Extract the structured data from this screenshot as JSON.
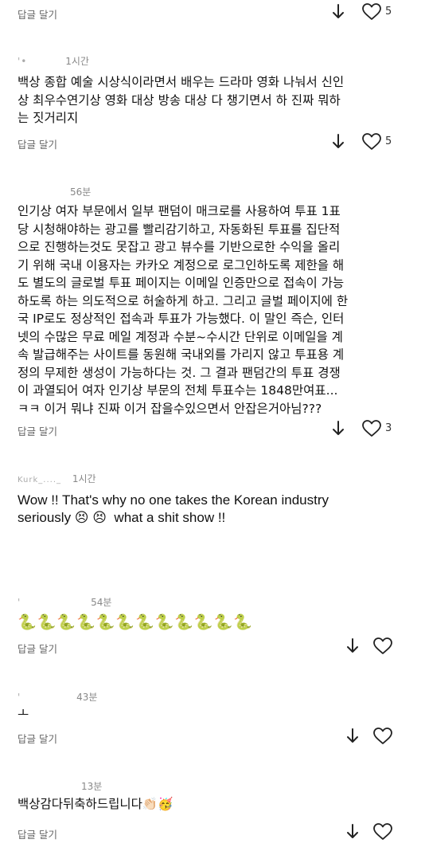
{
  "reply_label": "답글 달기",
  "comments": [
    {
      "time": "",
      "text": "",
      "likes": "5"
    },
    {
      "user": "'•",
      "time": "1시간",
      "text": "백상 종합 예술 시상식이라면서 배우는 드라마 영화 나눠서 신인\n상 최우수연기상 영화 대상 방송 대상 다 챙기면서 하 진짜 뭐하\n는 짓거리지",
      "likes": "5"
    },
    {
      "user": "",
      "time": "56분",
      "text": "인기상 여자 부문에서 일부 팬덤이 매크로를 사용하여 투표 1표\n당 시청해야하는 광고를 빨리감기하고, 자동화된 투표를 집단적\n으로 진행하는것도 못잡고 광고 뷰수를 기반으로한 수익을 올리\n기 위해 국내 이용자는 카카오 계정으로 로그인하도록 제한을 해\n도 별도의 글로벌 투표 페이지는 이메일 인증만으로 접속이 가능\n하도록 하는 의도적으로 허술하게 하고. 그리고 글벌 페이지에 한\n국 IP로도 정상적인 접속과 투표가 가능했다. 이 말인 즉슨, 인터\n넷의 수많은 무료 메일 계정과 수분~수시간 단위로 이메일을 계\n속 발급해주는 사이트를 동원해 국내외를 가리지 않고 투표용 계\n정의 무제한 생성이 가능하다는 것. 그 결과 팬덤간의 투표 경쟁\n이 과열되어 여자 인기상 부문의 전체 투표수는 1848만여표...\nㅋㅋ 이거 뭐냐 진짜 이거 잡을수있으면서 안잡은거아님???",
      "likes": "3"
    },
    {
      "user": "Kurk_...._",
      "time": "1시간",
      "text": "Wow !! That's why no one takes the Korean industry\nseriously 😣 😣  what a shit show !!",
      "likes": ""
    },
    {
      "user": "'",
      "time": "54분",
      "text": "🐍🐍🐍🐍🐍🐍🐍🐍🐍🐍🐍🐍",
      "likes": ""
    },
    {
      "user": "'",
      "time": "43분",
      "text": "ㅗ",
      "likes": ""
    },
    {
      "user": "",
      "time": "13분",
      "text": "백상감다뒤축하드립니다👏🏻🥳",
      "likes": ""
    }
  ],
  "colors": {
    "text": "#111111",
    "muted": "#888888",
    "reply": "#666666",
    "background": "#ffffff"
  },
  "icons": [
    "down-arrow-icon",
    "heart-icon"
  ]
}
